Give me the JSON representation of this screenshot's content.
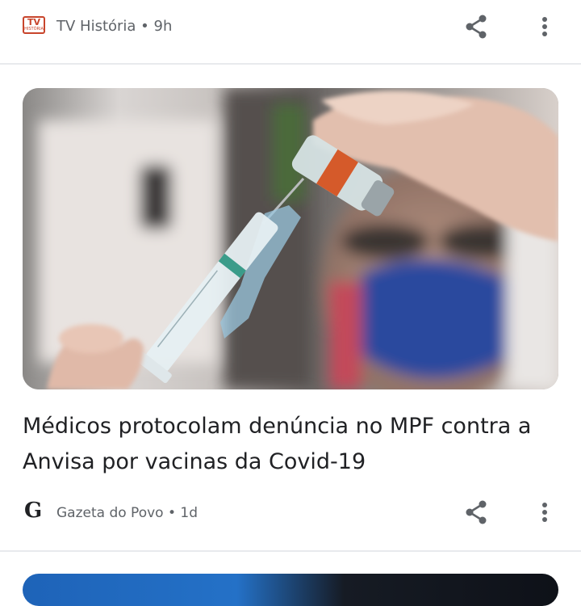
{
  "feed": {
    "top_item": {
      "source": "TV História",
      "age": "9h",
      "meta": "TV História • 9h",
      "logo_text": "TV",
      "logo_sub": "HISTÓRIA"
    },
    "card": {
      "headline": "Médicos protocolam denúncia no MPF contra a Anvisa por vacinas da Covid-19",
      "image_subject": "syringe-vaccine-photo",
      "source": "Gazeta do Povo",
      "age": "1d",
      "meta": "Gazeta do Povo • 1d",
      "logo_text": "G"
    }
  },
  "icons": {
    "share": "share-icon",
    "more": "more-vert-icon"
  },
  "colors": {
    "text": "#202124",
    "secondary_text": "#5f6368",
    "divider": "#e8eaed",
    "tv_logo": "#c8452c"
  }
}
